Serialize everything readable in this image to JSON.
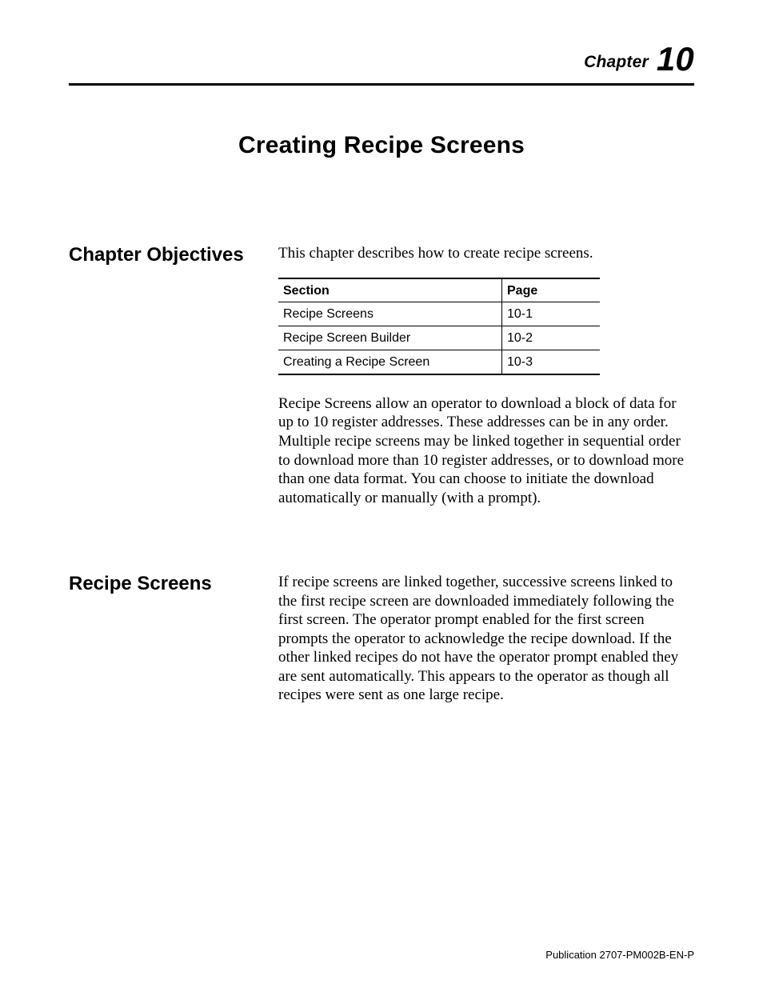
{
  "header": {
    "chapter_word": "Chapter",
    "chapter_number": "10"
  },
  "title": "Creating Recipe Screens",
  "objectives": {
    "heading": "Chapter Objectives",
    "intro": "This chapter describes how to create recipe screens.",
    "table": {
      "col_section": "Section",
      "col_page": "Page",
      "rows": [
        {
          "section": "Recipe Screens",
          "page": "10-1"
        },
        {
          "section": "Recipe Screen Builder",
          "page": "10-2"
        },
        {
          "section": "Creating a Recipe Screen",
          "page": "10-3"
        }
      ]
    },
    "para2": "Recipe Screens allow an operator to download a block of data for up to 10 register addresses. These addresses can be in any order. Multiple recipe screens may be linked together in sequential order to download more than 10 register addresses, or to download more than one data format. You can choose to initiate the download automatically or manually (with a prompt)."
  },
  "recipe_screens": {
    "heading": "Recipe Screens",
    "para": "If recipe screens are linked together, successive screens linked to the first recipe screen are downloaded immediately following the first screen. The operator prompt enabled for the first screen prompts the operator to acknowledge the recipe download. If the other linked recipes do not have the operator prompt enabled they are sent automatically. This appears to the operator as though all recipes were sent as one large recipe."
  },
  "footer": "Publication 2707-PM002B-EN-P"
}
